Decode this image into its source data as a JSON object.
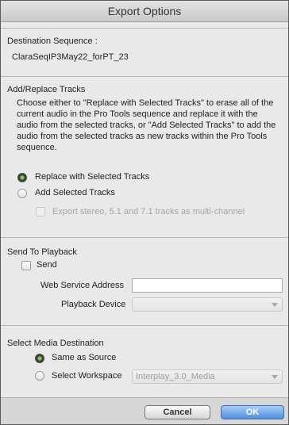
{
  "window": {
    "title": "Export Options"
  },
  "destination": {
    "label": "Destination Sequence :",
    "value": "ClaraSeqIP3May22_forPT_23"
  },
  "add_replace": {
    "heading": "Add/Replace Tracks",
    "description": "Choose either to \"Replace with Selected Tracks\" to erase all of the current audio in the Pro Tools sequence and replace it with the audio from the selected tracks, or \"Add Selected Tracks\" to add the audio from the selected tracks as new tracks within the Pro Tools sequence.",
    "replace_label": "Replace with Selected Tracks",
    "replace_selected": true,
    "add_label": "Add Selected Tracks",
    "add_selected": false,
    "multichannel_label": "Export stereo, 5.1 and 7.1 tracks as multi-channel",
    "multichannel_checked": false
  },
  "playback": {
    "heading": "Send To Playback",
    "send_label": "Send",
    "send_checked": false,
    "web_service_label": "Web Service Address",
    "web_service_value": "",
    "device_label": "Playback Device",
    "device_value": ""
  },
  "media": {
    "heading": "Select Media Destination",
    "same_source_label": "Same as Source",
    "same_source_selected": true,
    "workspace_label": "Select Workspace",
    "workspace_selected": false,
    "workspace_value": "Interplay_3.0_Media"
  },
  "buttons": {
    "cancel": "Cancel",
    "ok": "OK"
  }
}
